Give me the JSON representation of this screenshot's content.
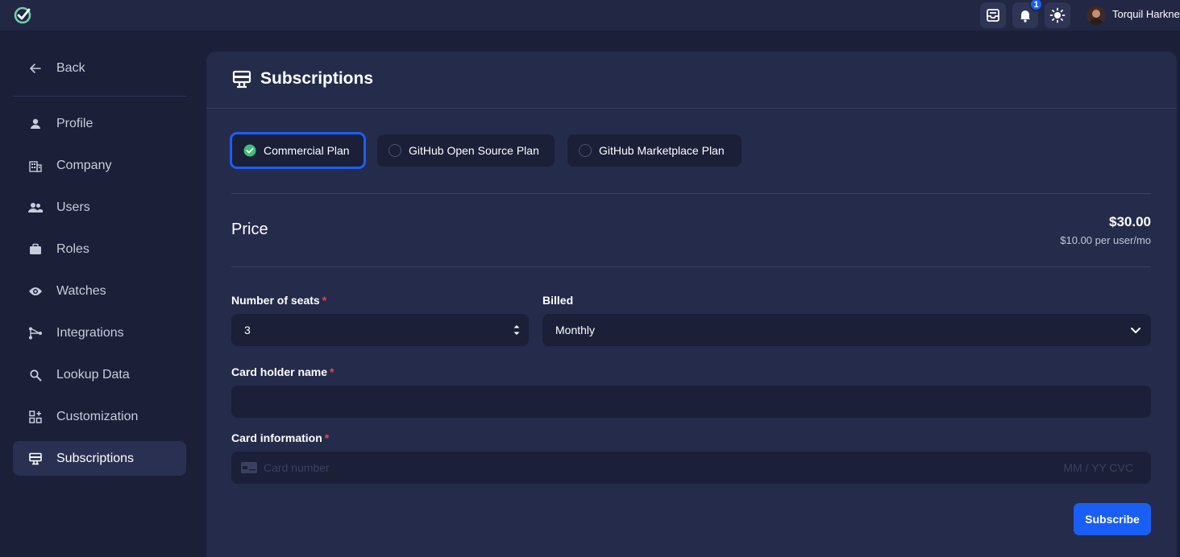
{
  "topbar": {
    "notification_count": "1",
    "user_name": "Torquil Harkness"
  },
  "sidebar": {
    "back_label": "Back",
    "items": [
      {
        "label": "Profile",
        "icon": "person-icon"
      },
      {
        "label": "Company",
        "icon": "building-icon"
      },
      {
        "label": "Users",
        "icon": "users-icon"
      },
      {
        "label": "Roles",
        "icon": "briefcase-icon"
      },
      {
        "label": "Watches",
        "icon": "eye-icon"
      },
      {
        "label": "Integrations",
        "icon": "integrations-icon"
      },
      {
        "label": "Lookup Data",
        "icon": "search-icon"
      },
      {
        "label": "Customization",
        "icon": "grid-icon"
      },
      {
        "label": "Subscriptions",
        "icon": "subscriptions-icon",
        "active": true
      }
    ]
  },
  "main": {
    "title": "Subscriptions",
    "plans": [
      {
        "label": "Commercial Plan",
        "selected": true
      },
      {
        "label": "GitHub Open Source Plan",
        "selected": false
      },
      {
        "label": "GitHub Marketplace Plan",
        "selected": false
      }
    ],
    "price_label": "Price",
    "price_amount": "$30.00",
    "price_detail": "$10.00 per user/mo",
    "seats_label": "Number of seats",
    "seats_value": "3",
    "billed_label": "Billed",
    "billed_value": "Monthly",
    "cardholder_label": "Card holder name",
    "cardholder_value": "",
    "card_info_label": "Card information",
    "card_number_placeholder": "Card number",
    "card_expiry_placeholder": "MM / YY  CVC",
    "required_mark": "*",
    "subscribe_label": "Subscribe"
  },
  "colors": {
    "accent": "#1a5ff5",
    "background": "#1b1f37",
    "panel": "#252b4a",
    "success": "#3cbf7a",
    "required": "#e5484d"
  }
}
